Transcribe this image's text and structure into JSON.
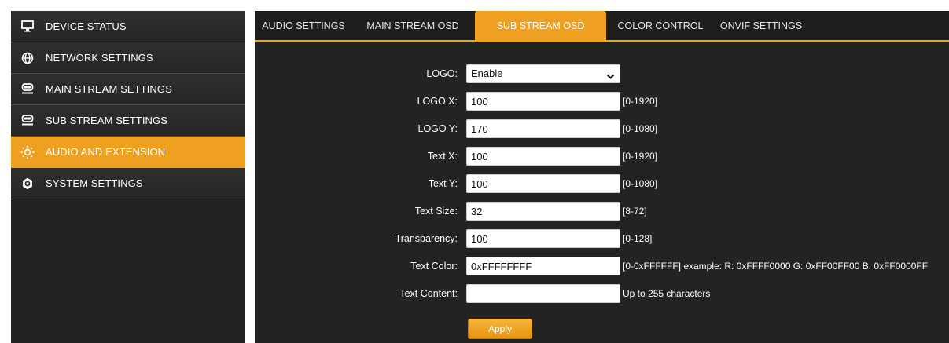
{
  "sidebar": {
    "items": [
      {
        "label": "DEVICE STATUS",
        "icon": "monitor-icon"
      },
      {
        "label": "NETWORK SETTINGS",
        "icon": "globe-icon"
      },
      {
        "label": "MAIN STREAM SETTINGS",
        "icon": "camera-icon"
      },
      {
        "label": "SUB STREAM SETTINGS",
        "icon": "camera-icon"
      },
      {
        "label": "AUDIO AND EXTENSION",
        "icon": "sun-dotted-icon",
        "active": true
      },
      {
        "label": "SYSTEM SETTINGS",
        "icon": "gear-icon"
      }
    ]
  },
  "tabs": [
    {
      "label": "AUDIO SETTINGS"
    },
    {
      "label": "MAIN STREAM OSD"
    },
    {
      "label": "SUB STREAM OSD",
      "active": true
    },
    {
      "label": "COLOR CONTROL"
    },
    {
      "label": "ONVIF SETTINGS"
    }
  ],
  "form": {
    "logo": {
      "label": "LOGO:",
      "value": "Enable",
      "options": [
        "Enable"
      ]
    },
    "logo_x": {
      "label": "LOGO X:",
      "value": "100",
      "hint": "[0-1920]"
    },
    "logo_y": {
      "label": "LOGO Y:",
      "value": "170",
      "hint": "[0-1080]"
    },
    "text_x": {
      "label": "Text X:",
      "value": "100",
      "hint": "[0-1920]"
    },
    "text_y": {
      "label": "Text Y:",
      "value": "100",
      "hint": "[0-1080]"
    },
    "text_size": {
      "label": "Text Size:",
      "value": "32",
      "hint": "[8-72]"
    },
    "transparency": {
      "label": "Transparency:",
      "value": "100",
      "hint": "[0-128]"
    },
    "text_color": {
      "label": "Text Color:",
      "value": "0xFFFFFFFF",
      "hint": "[0-0xFFFFFF] example: R: 0xFFFF0000 G: 0xFF00FF00 B: 0xFF0000FF"
    },
    "text_content": {
      "label": "Text Content:",
      "value": "",
      "hint": "Up to 255 characters"
    },
    "apply_label": "Apply"
  },
  "colors": {
    "accent": "#f0a020",
    "panel": "#232323",
    "text": "#ffffff"
  }
}
